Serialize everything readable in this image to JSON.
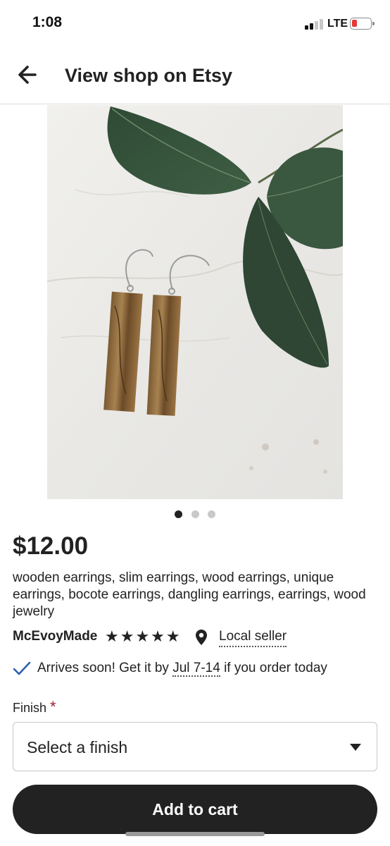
{
  "status": {
    "time": "1:08",
    "network": "LTE"
  },
  "header": {
    "title": "View shop on Etsy",
    "back_icon": "arrow-left-icon"
  },
  "carousel": {
    "total": 3,
    "active": 1
  },
  "product": {
    "price": "$12.00",
    "title": "wooden earrings, slim earrings, wood earrings, unique earrings, bocote earrings, dangling earrings, earrings, wood jewelry"
  },
  "seller": {
    "name": "McEvoyMade",
    "rating": 5,
    "stars": "★★★★★",
    "local_label": "Local seller"
  },
  "delivery": {
    "prefix": "Arrives soon! Get it by ",
    "date": "Jul 7-14",
    "suffix": " if you order today"
  },
  "finish": {
    "label": "Finish",
    "required_mark": "*",
    "placeholder": "Select a finish"
  },
  "actions": {
    "add_to_cart": "Add to cart"
  },
  "colors": {
    "accent": "#222222",
    "required": "#a61a2e",
    "check": "#2c5fb0",
    "battery": "#e53935"
  }
}
